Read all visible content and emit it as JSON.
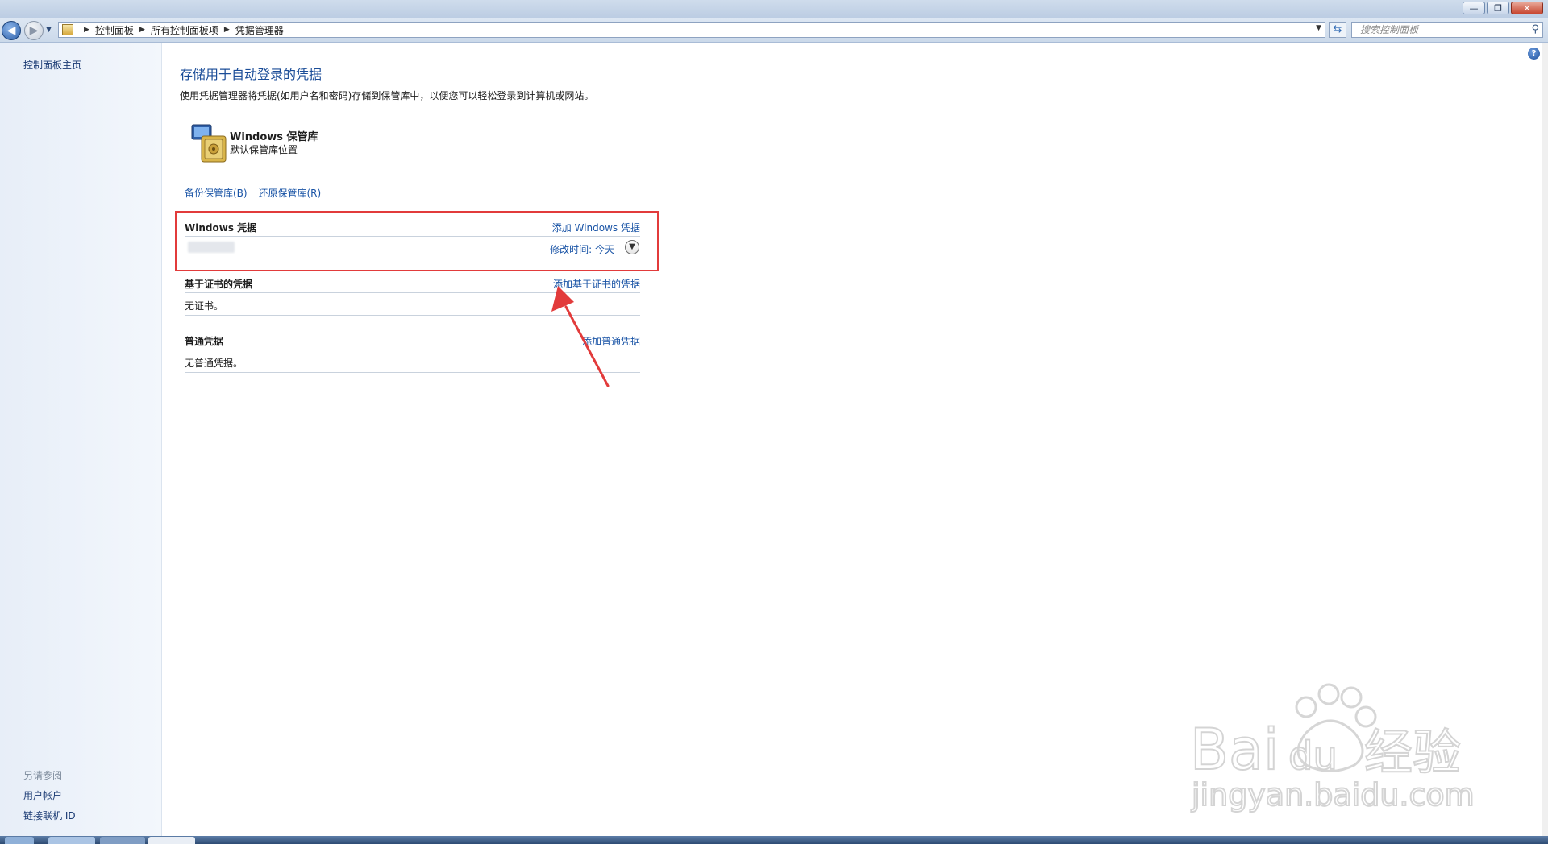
{
  "window": {
    "minimize_label": "—",
    "restore_label": "❐",
    "close_label": "✕"
  },
  "address_bar": {
    "breadcrumbs": [
      "控制面板",
      "所有控制面板项",
      "凭据管理器"
    ],
    "search_placeholder": "搜索控制面板"
  },
  "sidebar": {
    "home_link": "控制面板主页",
    "see_also_heading": "另请参阅",
    "links": [
      "用户帐户",
      "链接联机 ID"
    ]
  },
  "main": {
    "title": "存储用于自动登录的凭据",
    "description": "使用凭据管理器将凭据(如用户名和密码)存储到保管库中，以便您可以轻松登录到计算机或网站。",
    "vault": {
      "name": "Windows 保管库",
      "subtitle": "默认保管库位置"
    },
    "actions": {
      "backup": "备份保管库(B)",
      "restore": "还原保管库(R)"
    },
    "sections": [
      {
        "title": "Windows 凭据",
        "action": "添加 Windows 凭据",
        "entry_modified": "修改时间:  今天"
      },
      {
        "title": "基于证书的凭据",
        "action": "添加基于证书的凭据",
        "empty": "无证书。"
      },
      {
        "title": "普通凭据",
        "action": "添加普通凭据",
        "empty": "无普通凭据。"
      }
    ]
  },
  "watermark": {
    "brand": "Baidu经验",
    "url": "jingyan.baidu.com"
  },
  "colors": {
    "link": "#1a54a6",
    "title": "#1b4d98",
    "highlight": "#e23b3b",
    "arrow": "#e23b3b"
  }
}
